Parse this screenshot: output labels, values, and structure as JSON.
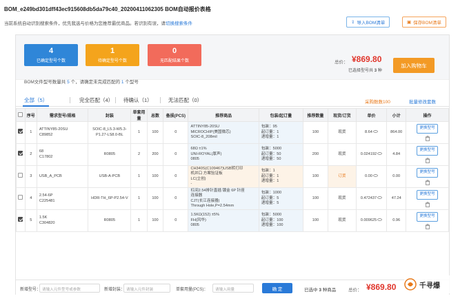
{
  "header": {
    "title": "BOM_e249bd301dff43ec915608db5da79c40_20200411062305 BOM自动报价表格",
    "subtitle": "当前系统自动识别搜索条件，优先我选与价格为您推荐最优商品。若识别有误，请",
    "subtitle_link": "切换搜索条件",
    "import_btn": "导入BOM清单",
    "save_btn": "保存BOM清单"
  },
  "summary": {
    "cards": [
      {
        "num": "4",
        "label": "已确定型号个数",
        "color": "#2f86d8"
      },
      {
        "num": "1",
        "label": "待确定型号个数",
        "color": "#f4a41c"
      },
      {
        "num": "0",
        "label": "无匹配结果个数",
        "color": "#f26b5b"
      }
    ],
    "total_label": "总价：",
    "total_value": "¥869.80",
    "selected_prefix": "已选择型号共",
    "selected_count": "3",
    "selected_suffix": "种",
    "cart_btn": "加入购物车"
  },
  "note": {
    "prefix": "BOM文件型号数量共",
    "total": "5",
    "mid": "个，请确定未完成匹配的",
    "pending": "1",
    "suffix": "个型号"
  },
  "tabs": [
    {
      "label": "全部（5）",
      "active": true
    },
    {
      "label": "完全匹配（4）",
      "active": false
    },
    {
      "label": "待确认（1）",
      "active": false
    },
    {
      "label": "无法匹配（0）",
      "active": false
    }
  ],
  "purchase": "采购数数100",
  "batch": "批量修改套数",
  "columns": [
    "",
    "序号",
    "需求型号/规格",
    "封装",
    "单套用量",
    "总数",
    "备损(PCS)",
    "推荐商品",
    "包装/起订量",
    "推荐数量",
    "现货/订货",
    "单价",
    "小计",
    "操作"
  ],
  "rows": [
    {
      "checked": true,
      "idx": "1",
      "spec1": "ATTINY85-20SU",
      "spec2": "C89852",
      "pkg": "SOIC-8_L5.3-W5.3-P1.27-LS8.0-BL",
      "unit": "1",
      "total": "100",
      "loss": "0",
      "prod": [
        "ATTINY85-20SU",
        "MICROCHIP(美国微芯)",
        "SOIC-8_208mil"
      ],
      "pack": [
        "包装：95",
        "起订量：1",
        "递增量：1"
      ],
      "qty": "100",
      "stock": "现货",
      "price": "8.64",
      "sub": "864.00",
      "action": "更换型号"
    },
    {
      "checked": true,
      "idx": "2",
      "spec1": "68",
      "spec2": "C17802",
      "pkg": "R0805",
      "unit": "2",
      "total": "200",
      "loss": "0",
      "prod": [
        "68Ω ±1%",
        "UNI-ROYAL(厚声)",
        "0805"
      ],
      "pack": [
        "包装：5000",
        "起订量：50",
        "递增量：50"
      ],
      "qty": "200",
      "stock": "现货",
      "price": "0.024192",
      "sub": "4.84",
      "action": "更换型号"
    },
    {
      "checked": false,
      "idx": "3",
      "spec1": "USB_A_PCB",
      "spec2": "",
      "pkg": "USB-A-PCB",
      "unit": "1",
      "total": "100",
      "loss": "0",
      "prod": [
        "CH340S(C109467)USB转打印",
        "机并口 方案验证板",
        "LC(立创)",
        "-"
      ],
      "pack": [
        "包装：1",
        "起订量：1",
        "递增量：1"
      ],
      "qty": "100",
      "stock": "订货",
      "price": "0.00",
      "sub": "0.00",
      "action": "更换型号"
    },
    {
      "checked": false,
      "idx": "4",
      "spec1": "2.54-6P",
      "spec2": "C225481",
      "pkg": "HDR-TH_6P-P2.54-V",
      "unit": "1",
      "total": "100",
      "loss": "0",
      "prod": [
        "杠间2.54排针直插 镀金 6P 针座",
        "连接器",
        "CJT(长江连接器)",
        "Through Hole,P=2.54mm"
      ],
      "pack": [
        "包装：1000",
        "起订量：5",
        "递增量：5"
      ],
      "qty": "100",
      "stock": "现货",
      "price": "0.472437",
      "sub": "47.24",
      "action": "更换型号"
    },
    {
      "checked": true,
      "idx": "5",
      "spec1": "1.5K",
      "spec2": "C304820",
      "pkg": "R0805",
      "unit": "1",
      "total": "100",
      "loss": "0",
      "prod": [
        "1.5KΩ(152) ±5%",
        "FH(风华)",
        "0805"
      ],
      "pack": [
        "包装：5000",
        "起订量：100",
        "递增量：100"
      ],
      "qty": "100",
      "stock": "现货",
      "price": "0.009625",
      "sub": "0.96",
      "action": "更换型号"
    }
  ],
  "footer": {
    "new_model_label": "新增型号：",
    "new_model_ph": "请输入元件型号或参数",
    "new_pkg_label": "新增封装：",
    "new_pkg_ph": "请输入元件封装",
    "unit_label": "单套用量(PCS)：",
    "unit_ph": "请输入用量",
    "confirm": "确 定",
    "selected_prefix": "已选中",
    "selected_count": "3",
    "selected_suffix": "种商品",
    "total_label": "总价：",
    "total_value": "¥869.80"
  },
  "watermark": "千寻爆"
}
